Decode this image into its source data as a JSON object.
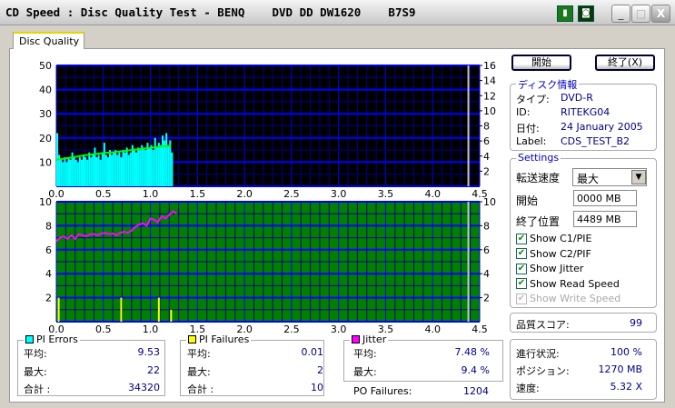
{
  "window": {
    "title": "CD Speed : Disc Quality Test - BENQ    DVD DD DW1620    B7S9",
    "icons": [
      "copy-icon",
      "save-icon"
    ],
    "controls": [
      "minimize-icon",
      "maximize-icon",
      "close-icon"
    ]
  },
  "tab": {
    "label": "Disc Quality"
  },
  "buttons": {
    "start": "開始",
    "exit": "終了(X)"
  },
  "disc_info": {
    "title": "ディスク情報",
    "rows": [
      {
        "label": "タイプ:",
        "value": "DVD-R"
      },
      {
        "label": "ID:",
        "value": "RITEKG04"
      },
      {
        "label": "日付:",
        "value": "24 January 2005"
      },
      {
        "label": "Label:",
        "value": "CDS_TEST_B2"
      }
    ]
  },
  "settings": {
    "title": "Settings",
    "speed_label": "転送速度",
    "speed_value": "最大",
    "start_label": "開始",
    "start_value": "0000 MB",
    "end_label": "終了位置",
    "end_value": "4489 MB",
    "checkboxes": [
      {
        "label": "Show C1/PIE",
        "checked": true,
        "enabled": true
      },
      {
        "label": "Show C2/PIF",
        "checked": true,
        "enabled": true
      },
      {
        "label": "Show Jitter",
        "checked": true,
        "enabled": true
      },
      {
        "label": "Show Read Speed",
        "checked": true,
        "enabled": true
      },
      {
        "label": "Show Write Speed",
        "checked": true,
        "enabled": false
      }
    ]
  },
  "quality": {
    "label": "品質スコア:",
    "value": "99"
  },
  "progress": {
    "rows": [
      {
        "label": "進行状況:",
        "value": "100 %"
      },
      {
        "label": "ポジション:",
        "value": "1270 MB"
      },
      {
        "label": "速度:",
        "value": "5.32 X"
      }
    ]
  },
  "pi_errors": {
    "title": "PI Errors",
    "color": "#00ffff",
    "rows": [
      {
        "label": "平均:",
        "value": "9.53"
      },
      {
        "label": "最大:",
        "value": "22"
      },
      {
        "label": "合計 :",
        "value": "34320"
      }
    ]
  },
  "pi_failures": {
    "title": "PI Failures",
    "color": "#ffff00",
    "rows": [
      {
        "label": "平均:",
        "value": "0.01"
      },
      {
        "label": "最大:",
        "value": "2"
      },
      {
        "label": "合計 :",
        "value": "10"
      }
    ]
  },
  "jitter": {
    "title": "Jitter",
    "color": "#ff00ff",
    "rows": [
      {
        "label": "平均:",
        "value": "7.48 %"
      },
      {
        "label": "最大:",
        "value": "9.4 %"
      }
    ]
  },
  "po_failures": {
    "label": "PO Failures:",
    "value": "1204"
  },
  "chart_data": [
    {
      "type": "bar",
      "name": "PI Errors / Read Speed",
      "xlim": [
        0,
        4.5
      ],
      "ylim": [
        0,
        50
      ],
      "y2lim": [
        0,
        16
      ],
      "xticks": [
        "0.0",
        "0.5",
        "1.0",
        "1.5",
        "2.0",
        "2.5",
        "3.0",
        "3.5",
        "4.0",
        "4.5"
      ],
      "yticks": [
        "50",
        "40",
        "30",
        "20",
        "10"
      ],
      "y2ticks": [
        "16",
        "14",
        "12",
        "10",
        "8",
        "6",
        "4",
        "2"
      ],
      "background": "#000000",
      "bar_color": "#00ffff",
      "speed_color": "#00ff00",
      "disc_end": 4.38,
      "pi_x_step": 0.02,
      "pi_errors": [
        22,
        13,
        11,
        10,
        12,
        10,
        12,
        11,
        14,
        12,
        11,
        10,
        12,
        11,
        13,
        12,
        11,
        14,
        12,
        13,
        16,
        12,
        13,
        11,
        14,
        18,
        13,
        12,
        15,
        13,
        14,
        15,
        13,
        14,
        12,
        15,
        14,
        16,
        13,
        14,
        17,
        15,
        14,
        16,
        15,
        17,
        16,
        15,
        18,
        16,
        17,
        15,
        20,
        16,
        18,
        17,
        21,
        19,
        22,
        17,
        19,
        14
      ],
      "read_speed_x": [
        0,
        0.1,
        0.2,
        0.3,
        0.4,
        0.5,
        0.6,
        0.7,
        0.8,
        0.9,
        1.0,
        1.1,
        1.22
      ],
      "read_speed": [
        3.5,
        3.7,
        3.9,
        4.1,
        4.25,
        4.4,
        4.5,
        4.65,
        4.8,
        4.95,
        5.1,
        5.25,
        5.35
      ]
    },
    {
      "type": "line",
      "name": "Jitter / PI Failures",
      "xlim": [
        0,
        4.5
      ],
      "ylim": [
        0,
        10
      ],
      "xticks": [
        "0.0",
        "0.5",
        "1.0",
        "1.5",
        "2.0",
        "2.5",
        "3.0",
        "3.5",
        "4.0",
        "4.5"
      ],
      "yticks": [
        "10",
        "8",
        "6",
        "4",
        "2"
      ],
      "y2ticks": [
        "10",
        "8",
        "6",
        "4",
        "2"
      ],
      "background": "#008000",
      "jitter_color": "#ff00ff",
      "pif_color": "#ffff00",
      "disc_end": 4.38,
      "jitter_x_step": 0.04,
      "jitter": [
        6.7,
        7.0,
        7.1,
        6.9,
        7.2,
        6.9,
        7.3,
        7.2,
        7.1,
        7.3,
        7.3,
        7.2,
        7.35,
        7.4,
        7.3,
        7.35,
        7.2,
        7.4,
        7.5,
        7.4,
        7.6,
        7.9,
        8.1,
        8.2,
        8.0,
        8.6,
        8.5,
        8.3,
        8.8,
        8.6,
        8.9,
        9.2,
        9.0
      ],
      "pi_failures": [
        {
          "x": 0.025,
          "y": 2
        },
        {
          "x": 0.69,
          "y": 2
        },
        {
          "x": 1.09,
          "y": 2
        },
        {
          "x": 1.22,
          "y": 1
        }
      ]
    }
  ]
}
